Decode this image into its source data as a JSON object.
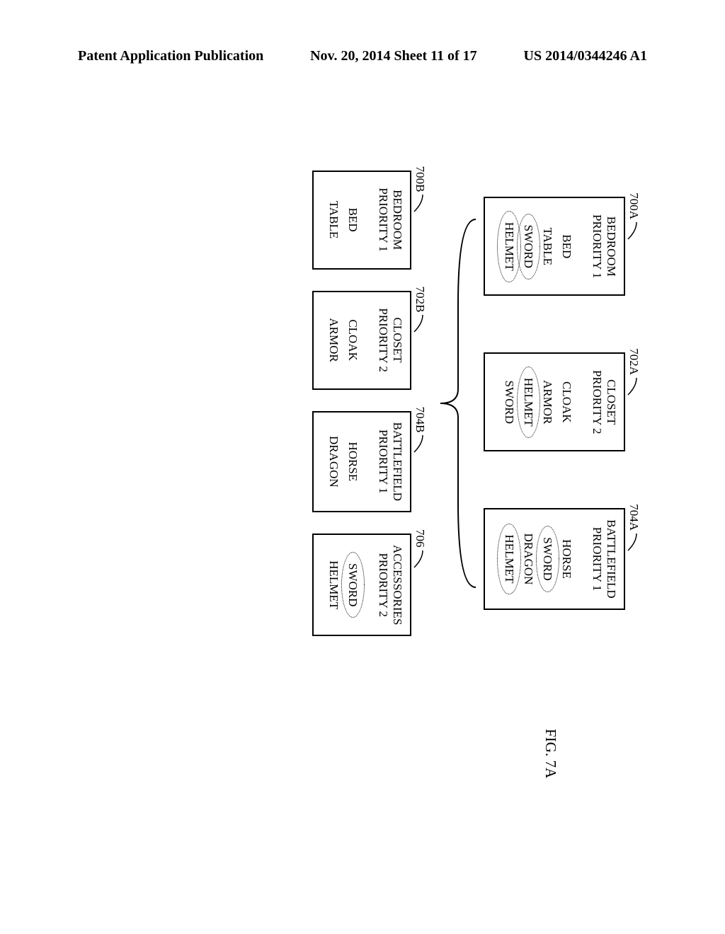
{
  "header": {
    "left": "Patent Application Publication",
    "middle": "Nov. 20, 2014  Sheet 11 of 17",
    "right": "US 2014/0344246 A1"
  },
  "figure_label": "FIG. 7A",
  "top_row": [
    {
      "ref": "700A",
      "title_line1": "BEDROOM",
      "title_line2": "PRIORITY 1",
      "items": [
        {
          "text": "BED",
          "circled": false
        },
        {
          "text": "TABLE",
          "circled": false
        },
        {
          "text": "SWORD",
          "circled": true
        },
        {
          "text": "HELMET",
          "circled": true
        }
      ]
    },
    {
      "ref": "702A",
      "title_line1": "CLOSET",
      "title_line2": "PRIORITY 2",
      "items": [
        {
          "text": "CLOAK",
          "circled": false
        },
        {
          "text": "ARMOR",
          "circled": false
        },
        {
          "text": "HELMET",
          "circled": true
        },
        {
          "text": "SWORD",
          "circled": false
        }
      ]
    },
    {
      "ref": "704A",
      "title_line1": "BATTLEFIELD",
      "title_line2": "PRIORITY 1",
      "items": [
        {
          "text": "HORSE",
          "circled": false
        },
        {
          "text": "SWORD",
          "circled": true
        },
        {
          "text": "DRAGON",
          "circled": false
        },
        {
          "text": "HELMET",
          "circled": true
        }
      ]
    }
  ],
  "bottom_row": [
    {
      "ref": "700B",
      "title_line1": "BEDROOM",
      "title_line2": "PRIORITY 1",
      "items": [
        {
          "text": "BED",
          "circled": false
        },
        {
          "text": "TABLE",
          "circled": false
        }
      ]
    },
    {
      "ref": "702B",
      "title_line1": "CLOSET",
      "title_line2": "PRIORITY 2",
      "items": [
        {
          "text": "CLOAK",
          "circled": false
        },
        {
          "text": "ARMOR",
          "circled": false
        }
      ]
    },
    {
      "ref": "704B",
      "title_line1": "BATTLEFIELD",
      "title_line2": "PRIORITY 1",
      "items": [
        {
          "text": "HORSE",
          "circled": false
        },
        {
          "text": "DRAGON",
          "circled": false
        }
      ]
    },
    {
      "ref": "706",
      "title_line1": "ACCESSORIES",
      "title_line2": "PRIORITY 2",
      "items": [
        {
          "text": "SWORD",
          "circled": true
        },
        {
          "text": "HELMET",
          "circled": false
        }
      ]
    }
  ]
}
